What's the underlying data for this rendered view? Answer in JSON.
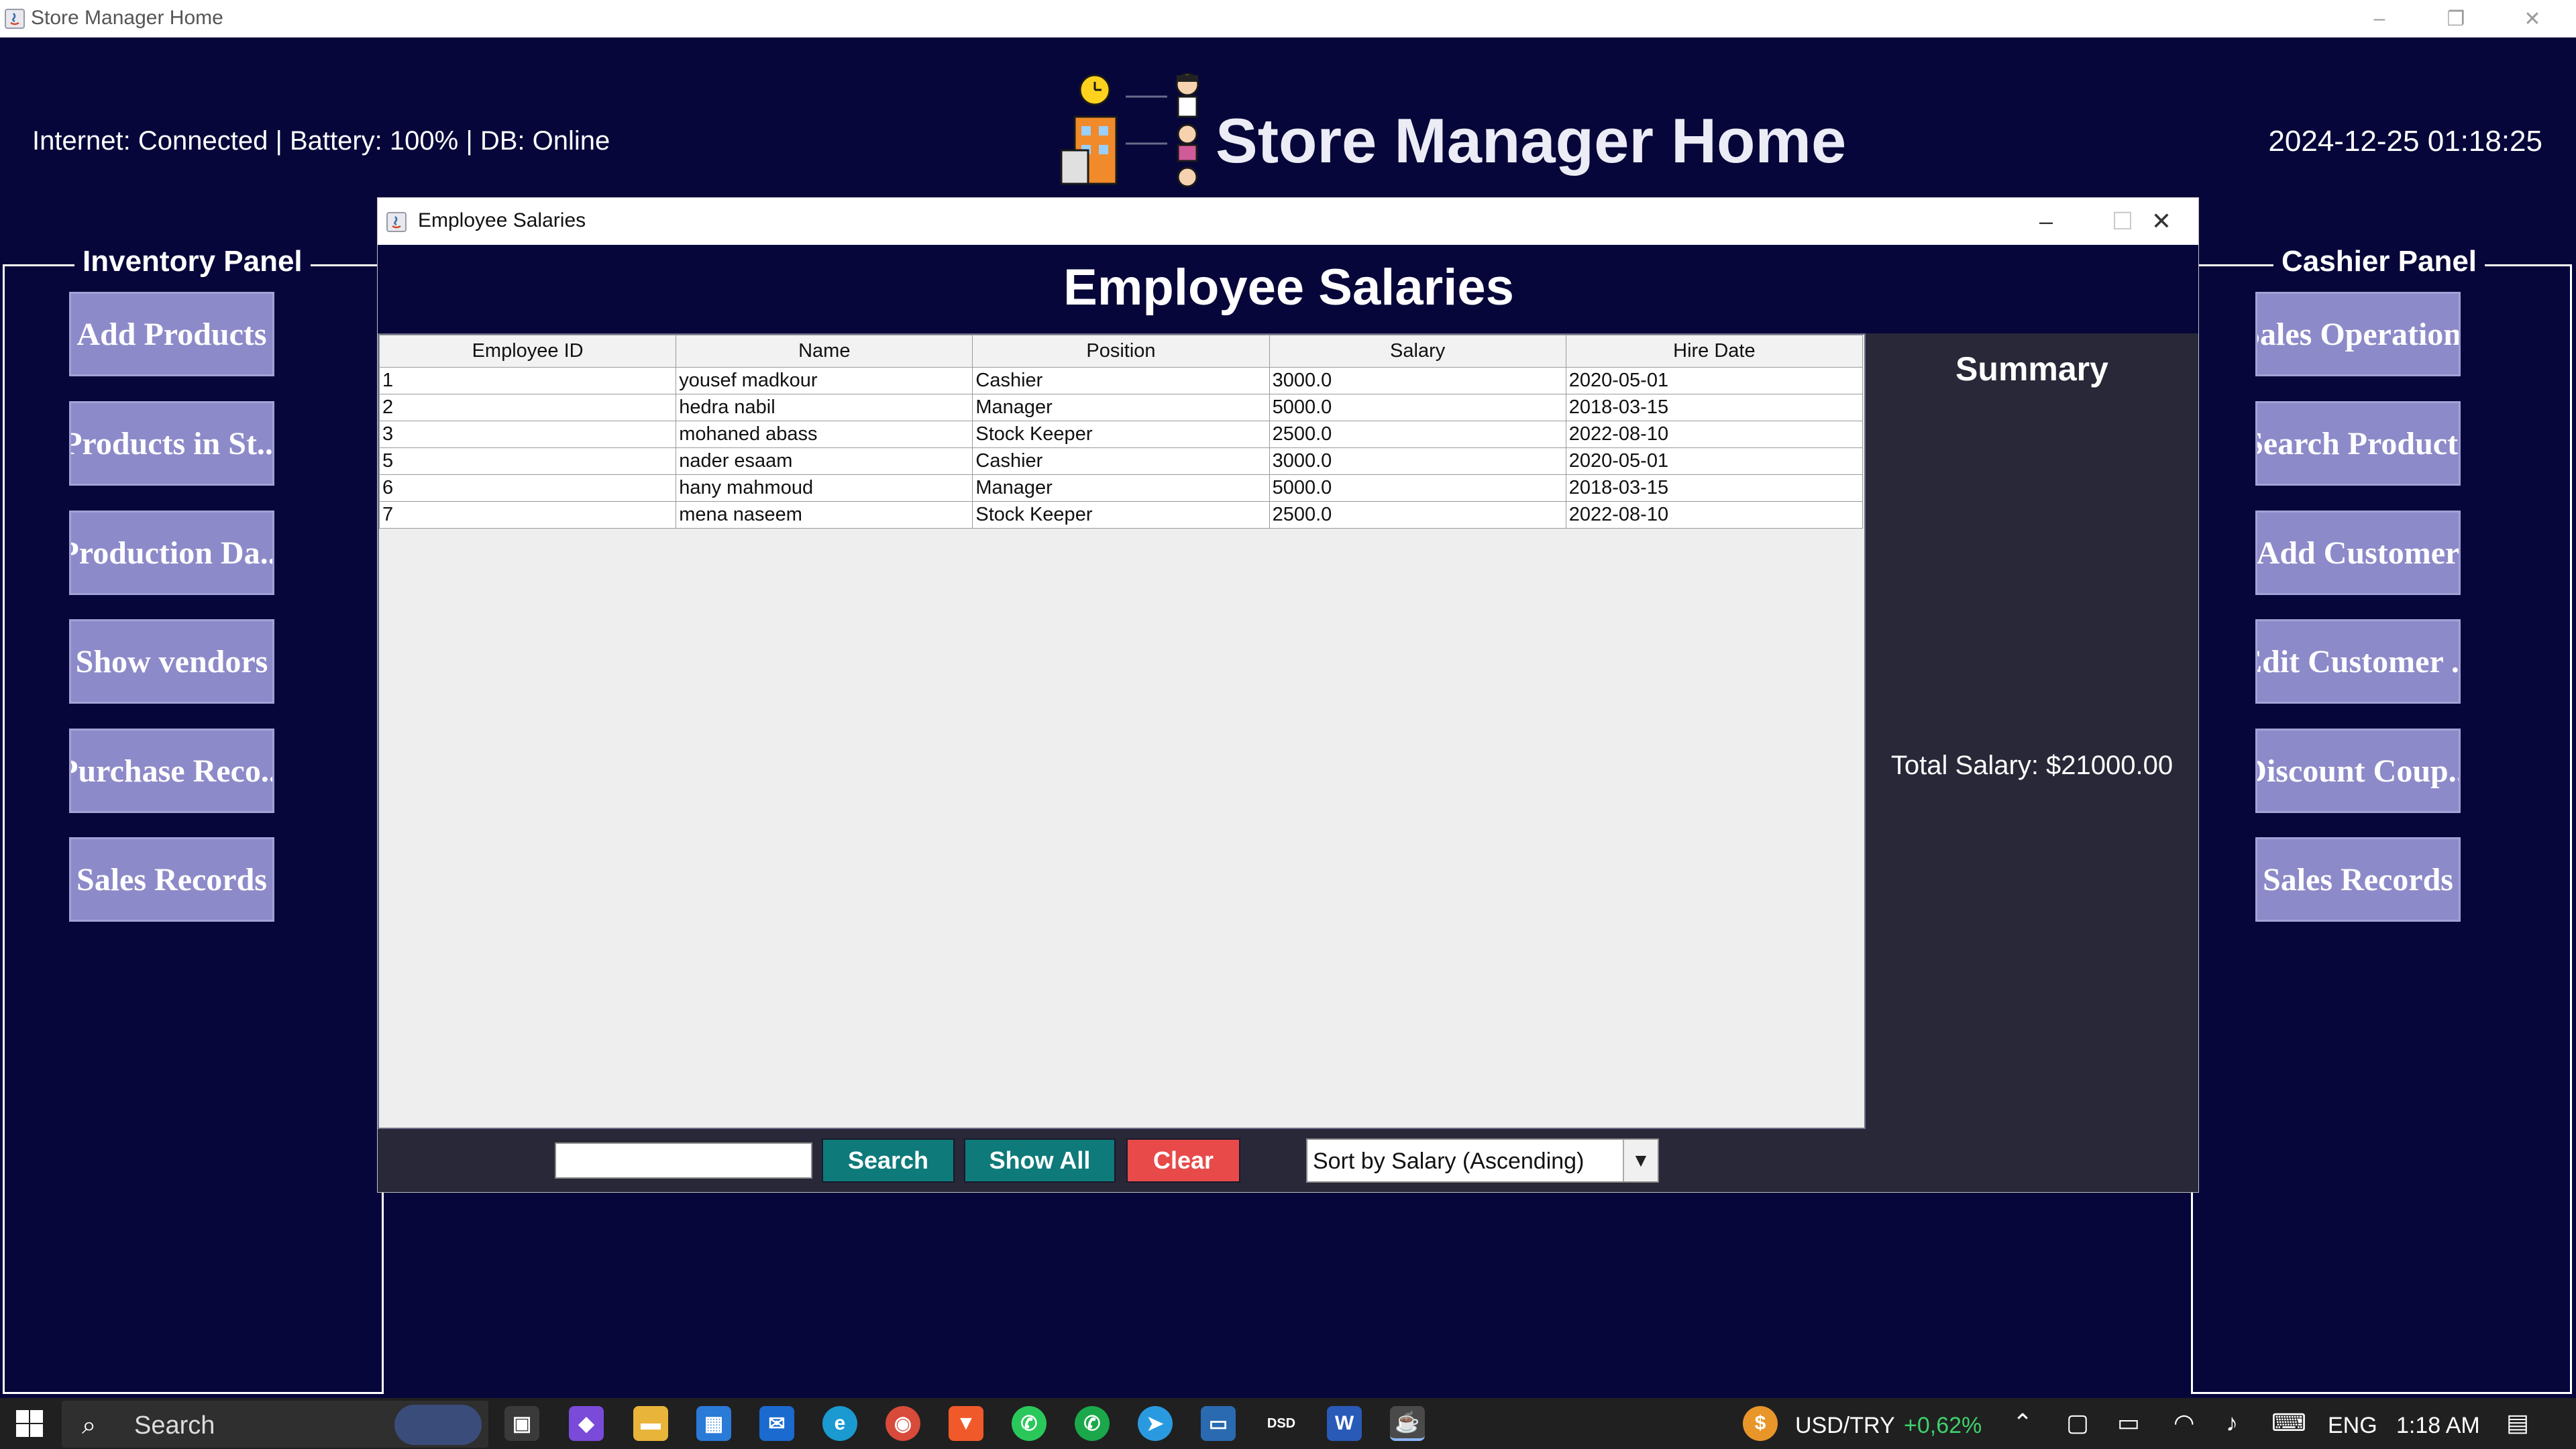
{
  "window": {
    "title": "Store Manager Home",
    "controls": {
      "minimize": "–",
      "restore": "❐",
      "close": "✕"
    }
  },
  "header": {
    "status": "Internet: Connected | Battery: 100% | DB:  Online",
    "title": "Store Manager Home",
    "datetime": "2024-12-25 01:18:25"
  },
  "inventory_panel": {
    "title": "Inventory Panel",
    "buttons": [
      "Add Products",
      "Products in St...",
      "Production Da...",
      "Show vendors",
      "Purchase Reco...",
      "Sales Records"
    ]
  },
  "cashier_panel": {
    "title": "Cashier Panel",
    "buttons": [
      "Sales Operations",
      "Search Products",
      "Add Customer",
      "Edit Customer ...",
      "Discount Coup...",
      "Sales Records"
    ]
  },
  "dialog": {
    "window_title": "Employee Salaries",
    "heading": "Employee Salaries",
    "controls": {
      "minimize": "–",
      "maximize": "☐",
      "close": "✕"
    },
    "table": {
      "columns": [
        "Employee ID",
        "Name",
        "Position",
        "Salary",
        "Hire Date"
      ],
      "rows": [
        [
          "1",
          "yousef madkour",
          "Cashier",
          "3000.0",
          "2020-05-01"
        ],
        [
          "2",
          "hedra nabil",
          "Manager",
          "5000.0",
          "2018-03-15"
        ],
        [
          "3",
          "mohaned abass",
          "Stock Keeper",
          "2500.0",
          "2022-08-10"
        ],
        [
          "5",
          "nader esaam",
          "Cashier",
          "3000.0",
          "2020-05-01"
        ],
        [
          "6",
          "hany mahmoud",
          "Manager",
          "5000.0",
          "2018-03-15"
        ],
        [
          "7",
          "mena naseem",
          "Stock Keeper",
          "2500.0",
          "2022-08-10"
        ]
      ]
    },
    "summary": {
      "title": "Summary",
      "total": "Total Salary: $21000.00"
    },
    "search": {
      "value": "",
      "search_label": "Search",
      "show_all_label": "Show All",
      "clear_label": "Clear",
      "sort_value": "Sort by Salary (Ascending)"
    }
  },
  "taskbar": {
    "search_label": "Search",
    "ticker": "USD/TRY",
    "ticker_change": "+0,62%",
    "language": "ENG",
    "time": "1:18 AM"
  },
  "colors": {
    "background": "#06063a",
    "panel_button": "#8d8ac9",
    "search_button": "#0e7a7a",
    "clear_button": "#e84a4a",
    "summary_bg": "#282838",
    "ticker_up": "#3fd16b"
  }
}
